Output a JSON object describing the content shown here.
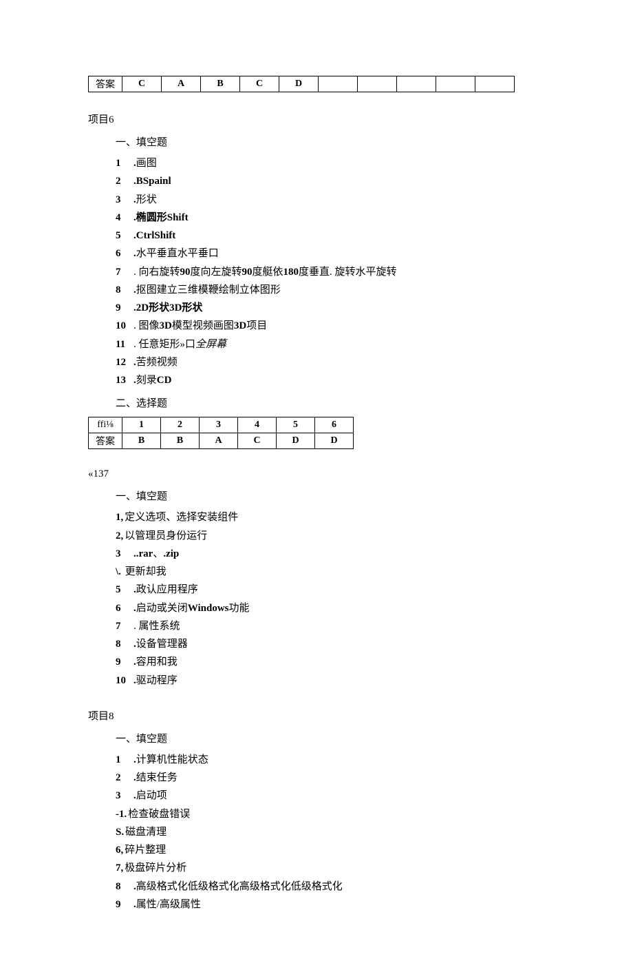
{
  "topTable": {
    "label": "答案",
    "cells": [
      "C",
      "A",
      "B",
      "C",
      "D",
      "",
      "",
      "",
      "",
      ""
    ]
  },
  "section6": {
    "title": "项目6",
    "sub1": "一、填空题",
    "items": [
      {
        "n": "1",
        "dot": ".",
        "text": "画图",
        "bold": false
      },
      {
        "n": "2",
        "dot": ".",
        "text": "BSpainl",
        "bold": true
      },
      {
        "n": "3",
        "dot": ".",
        "text": "形状",
        "bold": false
      },
      {
        "n": "4",
        "dot": ".",
        "text": "椭圆形Shift",
        "bold": true
      },
      {
        "n": "5",
        "dot": ".",
        "text": "CtrlShift",
        "bold": true
      },
      {
        "n": "6",
        "dot": ".",
        "text": "水平垂直水平垂口",
        "bold": false
      },
      {
        "n": "7",
        "dot": ". ",
        "text": "向右旋转90度向左旋转90度艇依180度垂直. 旋转水平旋转",
        "bold": false
      },
      {
        "n": "8",
        "dot": ".",
        "text": "抠图建立三维模鞭绘制立体图形",
        "bold": false
      },
      {
        "n": "9",
        "dot": ".",
        "text": "2D形状3D形状",
        "bold": true
      },
      {
        "n": "10",
        "dot": ". ",
        "text": "图像3D模型视频画图3D项目",
        "bold": false
      },
      {
        "n": "11",
        "dot": ". ",
        "text": "任意矩形»口全屏幕",
        "bold": false,
        "italic": true
      },
      {
        "n": "12",
        "dot": ".",
        "text": "苦频视频",
        "bold": false
      },
      {
        "n": "13",
        "dot": ".",
        "text": "刻录CD",
        "bold": true
      }
    ],
    "sub2": "二、选择题",
    "table": {
      "header_label": "ffi⅛",
      "header_cells": [
        "1",
        "2",
        "3",
        "4",
        "5",
        "6"
      ],
      "row_label": "答案",
      "row_cells": [
        "B",
        "B",
        "A",
        "C",
        "D",
        "D"
      ]
    }
  },
  "section7": {
    "title": "«137",
    "sub1": "一、填空题",
    "items": [
      {
        "n": "1,",
        "text": "定义选项、选择安装组件",
        "bold": false
      },
      {
        "n": "2,",
        "text": "以管理员身份运行",
        "bold": false
      },
      {
        "n": "3",
        "dot": "..",
        "text": "rar、.zip",
        "bold": true
      },
      {
        "n": "\\.",
        "text": " 更新却我",
        "bold": false,
        "raw": true
      },
      {
        "n": "5",
        "dot": ".",
        "text": "政认应用程序",
        "bold": false
      },
      {
        "n": "6",
        "dot": ".",
        "text": "启动或关闭Windows功能",
        "bold": false
      },
      {
        "n": "7",
        "dot": ". ",
        "text": "属性系统",
        "bold": false
      },
      {
        "n": "8",
        "dot": ".",
        "text": "设备管理器",
        "bold": false
      },
      {
        "n": "9",
        "dot": ".",
        "text": "容用和我",
        "bold": false
      },
      {
        "n": "10",
        "dot": ".",
        "text": "驱动程序",
        "bold": false
      }
    ]
  },
  "section8": {
    "title": "项目8",
    "sub1": "一、填空题",
    "items": [
      {
        "n": "1",
        "dot": ".",
        "text": "计算机性能状态",
        "bold": false
      },
      {
        "n": "2",
        "dot": ".",
        "text": "结束任务",
        "bold": false
      },
      {
        "n": "3",
        "dot": ".",
        "text": "启动项",
        "bold": false
      },
      {
        "n": "-1.",
        "text": "检查破盘错误",
        "bold": false,
        "raw": true
      },
      {
        "n": "S.",
        "text": "磁盘清理",
        "bold": false,
        "raw": true
      },
      {
        "n": "6,",
        "text": "碎片整理",
        "bold": false,
        "raw": true
      },
      {
        "n": "7,",
        "text": "极盘碎片分析",
        "bold": false,
        "raw": true
      },
      {
        "n": "8",
        "dot": ".",
        "text": "高级格式化低级格式化高级格式化低级格式化",
        "bold": false
      },
      {
        "n": "9",
        "dot": ".",
        "text": "属性/高级属性",
        "bold": false
      }
    ]
  }
}
